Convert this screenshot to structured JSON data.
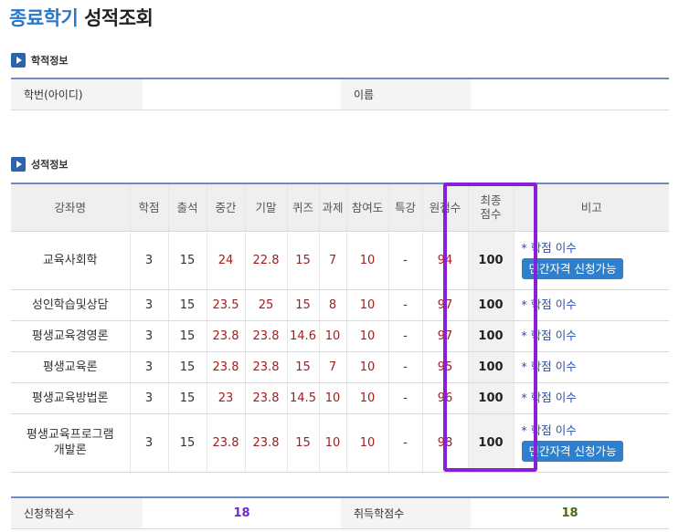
{
  "title": {
    "part1": "종료학기",
    "part2": "성적조회"
  },
  "student_section": {
    "title": "학적정보",
    "id_label": "학번(아이디)",
    "id_value": "",
    "name_label": "이름",
    "name_value": ""
  },
  "grades_section": {
    "title": "성적정보",
    "headers": {
      "course": "강좌명",
      "credit": "학점",
      "attendance": "출석",
      "midterm": "중간",
      "final_exam": "기말",
      "quiz": "퀴즈",
      "assignment": "과제",
      "participation": "참여도",
      "special": "특강",
      "raw_score": "원점수",
      "final_score_l1": "최종",
      "final_score_l2": "점수",
      "remarks": "비고"
    },
    "note_text": "* 학점 이수",
    "cert_button": "민간자격 신청가능",
    "rows": [
      {
        "course_l1": "교육사회학",
        "course_l2": "",
        "credit": "3",
        "attendance": "15",
        "midterm": "24",
        "final_exam": "22.8",
        "quiz": "15",
        "assignment": "7",
        "participation": "10",
        "special": "-",
        "raw_score": "94",
        "final_score": "100",
        "has_button": true
      },
      {
        "course_l1": "성인학습및상담",
        "course_l2": "",
        "credit": "3",
        "attendance": "15",
        "midterm": "23.5",
        "final_exam": "25",
        "quiz": "15",
        "assignment": "8",
        "participation": "10",
        "special": "-",
        "raw_score": "97",
        "final_score": "100",
        "has_button": false
      },
      {
        "course_l1": "평생교육경영론",
        "course_l2": "",
        "credit": "3",
        "attendance": "15",
        "midterm": "23.8",
        "final_exam": "23.8",
        "quiz": "14.6",
        "assignment": "10",
        "participation": "10",
        "special": "-",
        "raw_score": "97",
        "final_score": "100",
        "has_button": false
      },
      {
        "course_l1": "평생교육론",
        "course_l2": "",
        "credit": "3",
        "attendance": "15",
        "midterm": "23.8",
        "final_exam": "23.8",
        "quiz": "15",
        "assignment": "7",
        "participation": "10",
        "special": "-",
        "raw_score": "95",
        "final_score": "100",
        "has_button": false
      },
      {
        "course_l1": "평생교육방법론",
        "course_l2": "",
        "credit": "3",
        "attendance": "15",
        "midterm": "23",
        "final_exam": "23.8",
        "quiz": "14.5",
        "assignment": "10",
        "participation": "10",
        "special": "-",
        "raw_score": "96",
        "final_score": "100",
        "has_button": false
      },
      {
        "course_l1": "평생교육프로그램",
        "course_l2": "개발론",
        "credit": "3",
        "attendance": "15",
        "midterm": "23.8",
        "final_exam": "23.8",
        "quiz": "15",
        "assignment": "10",
        "participation": "10",
        "special": "-",
        "raw_score": "98",
        "final_score": "100",
        "has_button": true
      }
    ]
  },
  "summary": {
    "applied_label": "신청학점수",
    "applied_value": "18",
    "earned_label": "취득학점수",
    "earned_value": "18"
  },
  "colors": {
    "accent": "#2a78c8",
    "highlight": "#8a1fd9",
    "button": "#2e80cc",
    "score_red": "#a01e1e"
  }
}
